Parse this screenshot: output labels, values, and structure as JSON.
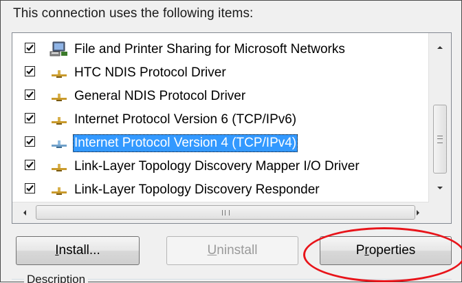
{
  "heading": "This connection uses the following items:",
  "items": [
    {
      "label": "File and Printer Sharing for Microsoft Networks",
      "checked": true,
      "icon": "network-computer-icon",
      "selected": false
    },
    {
      "label": "HTC NDIS Protocol Driver",
      "checked": true,
      "icon": "protocol-icon",
      "selected": false
    },
    {
      "label": "General NDIS Protocol Driver",
      "checked": true,
      "icon": "protocol-icon",
      "selected": false
    },
    {
      "label": "Internet Protocol Version 6 (TCP/IPv6)",
      "checked": true,
      "icon": "protocol-icon",
      "selected": false
    },
    {
      "label": "Internet Protocol Version 4 (TCP/IPv4)",
      "checked": true,
      "icon": "protocol-icon",
      "selected": true
    },
    {
      "label": "Link-Layer Topology Discovery Mapper I/O Driver",
      "checked": true,
      "icon": "protocol-icon",
      "selected": false
    },
    {
      "label": "Link-Layer Topology Discovery Responder",
      "checked": true,
      "icon": "protocol-icon",
      "selected": false
    }
  ],
  "buttons": {
    "install": {
      "prefix": "",
      "mnemonic": "I",
      "rest": "nstall..."
    },
    "uninstall": {
      "prefix": "",
      "mnemonic": "U",
      "rest": "ninstall"
    },
    "properties": {
      "prefix": "P",
      "mnemonic": "r",
      "rest": "operties"
    }
  },
  "description_label": "Description",
  "colors": {
    "selection": "#3399ff",
    "annotation_ring": "#e8141a"
  }
}
